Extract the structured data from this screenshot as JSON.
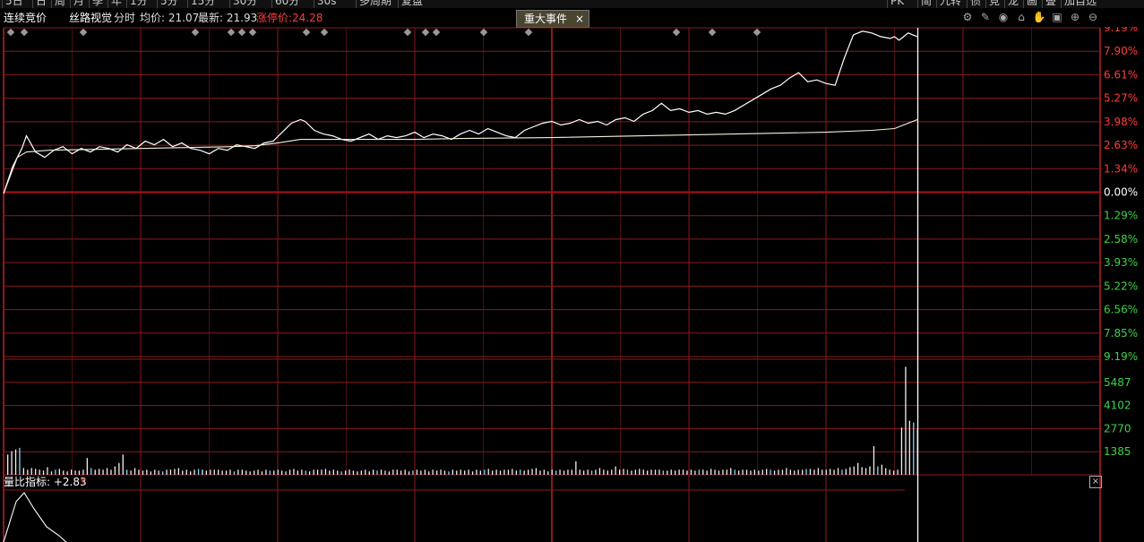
{
  "toolbar": {
    "left": [
      "5日",
      "日",
      "周",
      "月",
      "季",
      "年",
      "1分",
      "5分",
      "15分",
      "30分",
      "60分",
      "30s",
      "多周期",
      "复盘"
    ],
    "right": [
      "PK",
      "简",
      "九转",
      "债",
      "竞",
      "龙",
      "画",
      "叠",
      "加自选"
    ]
  },
  "info": {
    "mode": "连续竞价",
    "stock_name": "丝路视觉",
    "period": "分时",
    "avg_label": "均价: 21.07",
    "last_label": "最新: 21.93",
    "limit_label": "涨停价:24.28"
  },
  "event_tab": {
    "label": "重大事件",
    "close": "×"
  },
  "indicator": {
    "label": "量比指标: +2.83",
    "arrow": "↑",
    "close": "×"
  },
  "colors": {
    "background": "#000000",
    "grid": "#8b1a1a",
    "zero_line": "#b01010",
    "price": "#ffffff",
    "avg": "#f5f2d8",
    "volume": "#f0f0f0",
    "volume_alt": "#7fd7ff",
    "up": "#ff3b3b",
    "down": "#3cd24a",
    "axis_text": "#ffffff"
  },
  "chart_data": [
    {
      "type": "line",
      "name": "price",
      "y_unit": "%",
      "axis_labels": [
        "9.19%",
        "7.90%",
        "6.61%",
        "5.27%",
        "3.98%",
        "2.63%",
        "1.34%",
        "0.00%",
        "1.29%",
        "2.58%",
        "3.93%",
        "5.22%",
        "6.56%",
        "7.85%",
        "9.19%"
      ],
      "ylim": [
        -9.19,
        9.19
      ],
      "x_range": [
        0,
        240
      ],
      "cursor_x": 200,
      "series": [
        {
          "role": "price",
          "x": [
            0,
            2,
            4,
            5,
            7,
            9,
            11,
            13,
            15,
            17,
            19,
            21,
            23,
            25,
            27,
            29,
            31,
            33,
            35,
            37,
            39,
            41,
            43,
            45,
            47,
            49,
            51,
            53,
            55,
            57,
            59,
            61,
            63,
            65,
            66,
            68,
            70,
            72,
            74,
            76,
            78,
            80,
            82,
            84,
            86,
            88,
            90,
            92,
            94,
            96,
            98,
            100,
            102,
            104,
            106,
            108,
            110,
            112,
            114,
            116,
            118,
            120,
            122,
            124,
            126,
            128,
            130,
            132,
            134,
            136,
            138,
            140,
            142,
            144,
            146,
            148,
            150,
            152,
            154,
            156,
            158,
            160,
            162,
            164,
            166,
            168,
            170,
            172,
            174,
            176,
            178,
            180,
            182,
            184,
            186,
            188,
            190,
            192,
            194,
            195,
            196,
            197,
            198,
            199,
            200
          ],
          "y": [
            0.0,
            1.5,
            2.5,
            3.2,
            2.3,
            2.0,
            2.4,
            2.6,
            2.2,
            2.5,
            2.3,
            2.6,
            2.5,
            2.3,
            2.7,
            2.5,
            2.9,
            2.7,
            3.0,
            2.6,
            2.8,
            2.5,
            2.4,
            2.2,
            2.5,
            2.4,
            2.7,
            2.6,
            2.5,
            2.8,
            2.9,
            3.4,
            3.9,
            4.1,
            4.0,
            3.5,
            3.3,
            3.2,
            3.0,
            2.9,
            3.1,
            3.3,
            3.0,
            3.2,
            3.1,
            3.2,
            3.4,
            3.1,
            3.3,
            3.2,
            3.0,
            3.3,
            3.5,
            3.3,
            3.6,
            3.4,
            3.2,
            3.1,
            3.5,
            3.7,
            3.9,
            4.0,
            3.8,
            3.9,
            4.1,
            3.9,
            4.0,
            3.8,
            4.1,
            4.2,
            4.0,
            4.4,
            4.6,
            5.0,
            4.6,
            4.7,
            4.5,
            4.6,
            4.4,
            4.5,
            4.4,
            4.6,
            4.9,
            5.2,
            5.5,
            5.8,
            6.0,
            6.4,
            6.7,
            6.2,
            6.3,
            6.1,
            6.0,
            7.5,
            8.8,
            9.0,
            8.9,
            8.7,
            8.6,
            8.7,
            8.5,
            8.7,
            8.9,
            8.8,
            8.7
          ]
        },
        {
          "role": "avg",
          "x": [
            0,
            3,
            5,
            10,
            20,
            30,
            40,
            50,
            55,
            60,
            65,
            70,
            80,
            90,
            100,
            120,
            140,
            160,
            180,
            190,
            195,
            197,
            199,
            200
          ],
          "y": [
            0.0,
            2.0,
            2.3,
            2.4,
            2.45,
            2.5,
            2.55,
            2.6,
            2.65,
            2.8,
            3.0,
            3.0,
            3.0,
            3.0,
            3.05,
            3.1,
            3.2,
            3.3,
            3.4,
            3.5,
            3.6,
            3.8,
            4.0,
            4.1
          ]
        }
      ]
    },
    {
      "type": "bar",
      "name": "volume",
      "axis_labels": [
        "5487",
        "4102",
        "2770",
        "1385"
      ],
      "ylim": [
        0,
        6848
      ],
      "values": [
        1200,
        1400,
        1500,
        1600,
        400,
        300,
        400,
        350,
        300,
        250,
        450,
        200,
        300,
        350,
        250,
        200,
        300,
        250,
        250,
        300,
        1000,
        400,
        300,
        350,
        300,
        400,
        300,
        500,
        700,
        1200,
        300,
        250,
        400,
        300,
        250,
        300,
        200,
        300,
        250,
        200,
        300,
        300,
        350,
        400,
        250,
        300,
        200,
        300,
        350,
        300,
        250,
        300,
        300,
        300,
        250,
        250,
        300,
        200,
        300,
        300,
        250,
        200,
        250,
        300,
        200,
        300,
        250,
        250,
        300,
        250,
        200,
        300,
        350,
        250,
        300,
        250,
        200,
        300,
        300,
        300,
        350,
        250,
        300,
        250,
        200,
        250,
        300,
        250,
        200,
        250,
        300,
        200,
        300,
        250,
        300,
        250,
        200,
        300,
        300,
        250,
        300,
        200,
        250,
        300,
        250,
        300,
        200,
        300,
        250,
        300,
        250,
        200,
        300,
        250,
        300,
        250,
        300,
        200,
        300,
        250,
        300,
        350,
        250,
        300,
        250,
        300,
        300,
        350,
        250,
        300,
        250,
        300,
        350,
        400,
        250,
        300,
        200,
        300,
        250,
        300,
        250,
        300,
        300,
        800,
        300,
        250,
        300,
        250,
        300,
        400,
        300,
        250,
        300,
        500,
        300,
        350,
        300,
        250,
        300,
        350,
        300,
        250,
        300,
        300,
        300,
        250,
        250,
        300,
        250,
        300,
        300,
        250,
        300,
        250,
        300,
        300,
        250,
        350,
        300,
        250,
        300,
        300,
        400,
        300,
        250,
        300,
        300,
        250,
        300,
        250,
        300,
        350,
        300,
        250,
        300,
        300,
        400,
        300,
        250,
        300,
        300,
        350,
        350,
        300,
        400,
        300,
        300,
        350,
        300,
        400,
        300,
        350,
        450,
        500,
        700,
        450,
        400,
        500,
        1700,
        500,
        600,
        400,
        300,
        250,
        300,
        2800,
        6400,
        3200,
        3100,
        2700
      ],
      "highlight_index": [
        13,
        39,
        94,
        151,
        210
      ]
    }
  ]
}
